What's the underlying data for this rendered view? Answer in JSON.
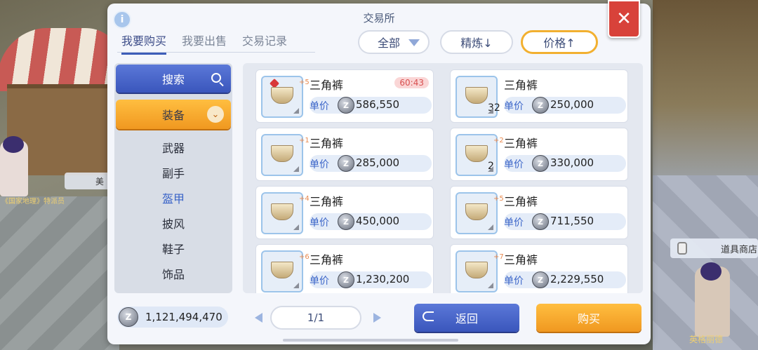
{
  "dialog": {
    "title": "交易所",
    "close_glyph": "✕",
    "info_glyph": "i"
  },
  "tabs": [
    {
      "label": "我要购买",
      "active": true
    },
    {
      "label": "我要出售",
      "active": false
    },
    {
      "label": "交易记录",
      "active": false
    }
  ],
  "filters": {
    "category": "全部",
    "refine": "精炼↓",
    "price": "价格↑"
  },
  "sidebar": {
    "search_label": "搜索",
    "equip_label": "装备",
    "chevron_glyph": "⌄",
    "items": [
      {
        "label": "武器",
        "active": false
      },
      {
        "label": "副手",
        "active": false
      },
      {
        "label": "盔甲",
        "active": true
      },
      {
        "label": "披风",
        "active": false
      },
      {
        "label": "鞋子",
        "active": false
      },
      {
        "label": "饰品",
        "active": false
      }
    ]
  },
  "listings": [
    {
      "name": "三角裤",
      "refine": "+5",
      "unit_label": "单价",
      "price": "586,550",
      "timer": "60:43",
      "qty": ""
    },
    {
      "name": "三角裤",
      "refine": "",
      "unit_label": "单价",
      "price": "250,000",
      "timer": "",
      "qty": "32"
    },
    {
      "name": "三角裤",
      "refine": "+1",
      "unit_label": "单价",
      "price": "285,000",
      "timer": "",
      "qty": ""
    },
    {
      "name": "三角裤",
      "refine": "+2",
      "unit_label": "单价",
      "price": "330,000",
      "timer": "",
      "qty": "2"
    },
    {
      "name": "三角裤",
      "refine": "+4",
      "unit_label": "单价",
      "price": "450,000",
      "timer": "",
      "qty": ""
    },
    {
      "name": "三角裤",
      "refine": "+5",
      "unit_label": "单价",
      "price": "711,550",
      "timer": "",
      "qty": ""
    },
    {
      "name": "三角裤",
      "refine": "+6",
      "unit_label": "单价",
      "price": "1,230,200",
      "timer": "",
      "qty": ""
    },
    {
      "name": "三角裤",
      "refine": "+7",
      "unit_label": "单价",
      "price": "2,229,550",
      "timer": "",
      "qty": ""
    }
  ],
  "wallet": {
    "balance": "1,121,494,470",
    "coin_glyph": "Z"
  },
  "pager": {
    "page": "1/1"
  },
  "buttons": {
    "back": "返回",
    "buy": "购买"
  },
  "scene": {
    "shop_tag": "道具商店",
    "npc_tag_left": "美",
    "npc_label_left": "《国家地理》特派员",
    "npc_label_right": "英格丽德"
  },
  "colors": {
    "accent_blue": "#3a56bc",
    "accent_orange": "#f09820",
    "close_red": "#d8423a"
  }
}
